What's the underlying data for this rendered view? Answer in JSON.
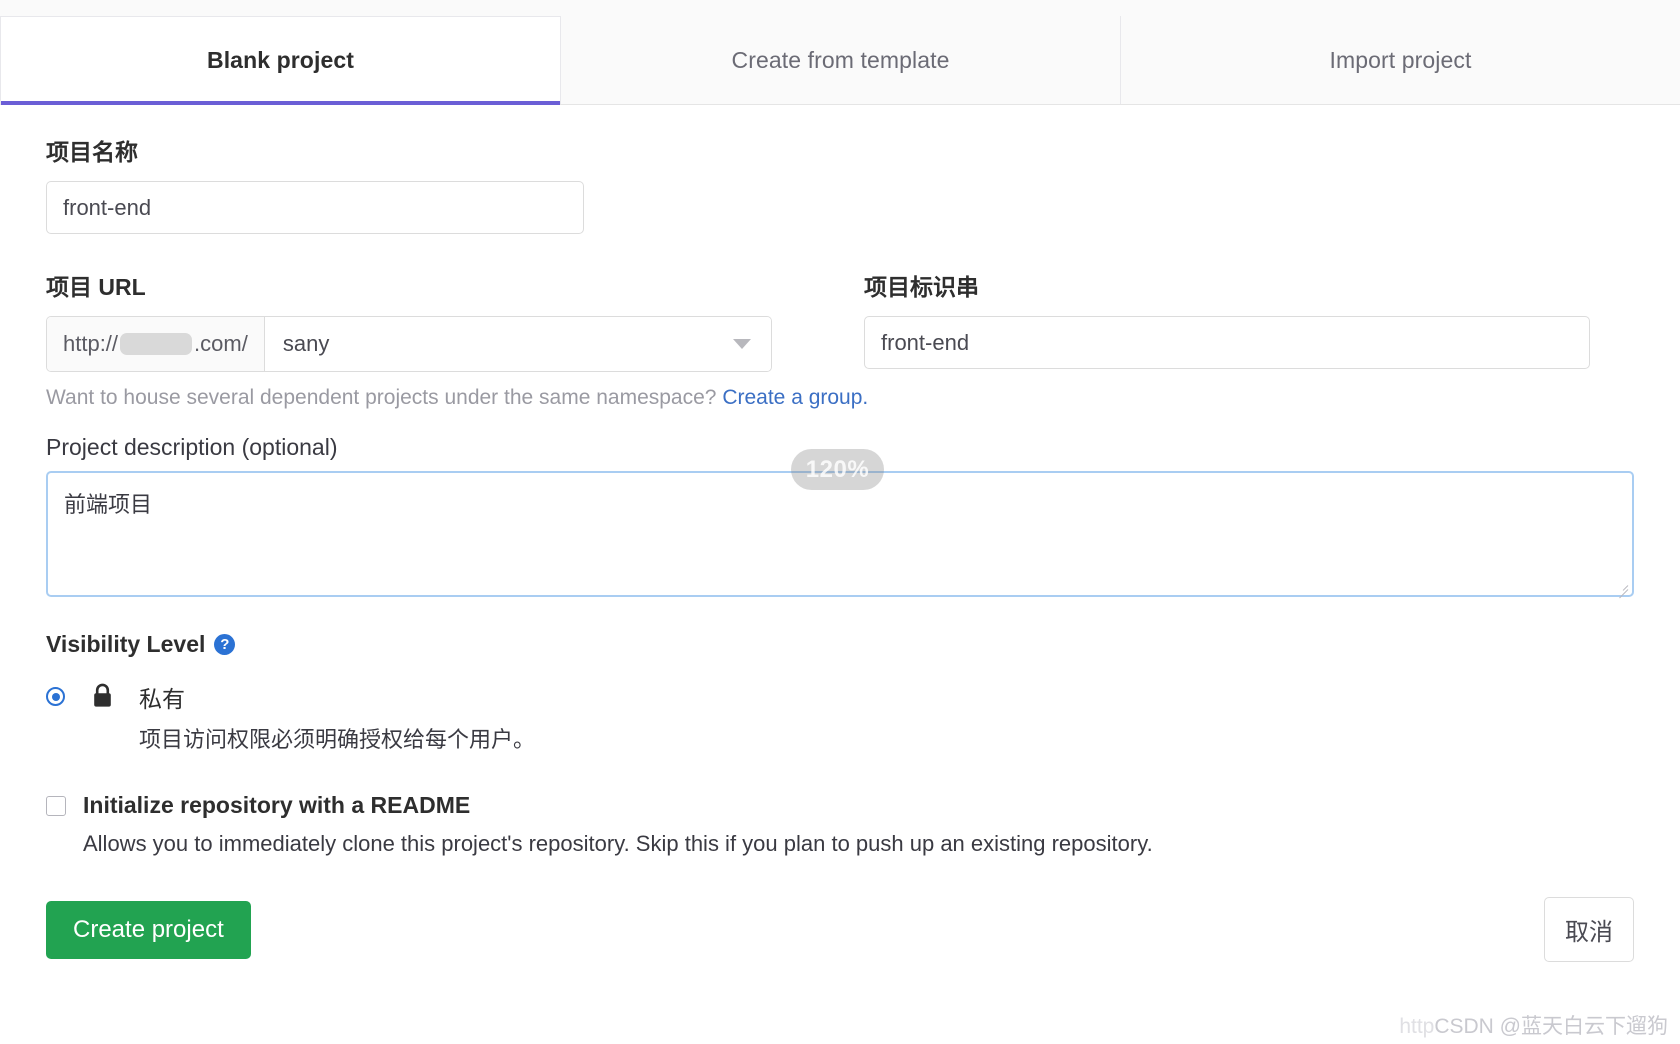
{
  "tabs": [
    {
      "label": "Blank project",
      "active": true
    },
    {
      "label": "Create from template",
      "active": false
    },
    {
      "label": "Import project",
      "active": false
    }
  ],
  "project_name": {
    "label": "项目名称",
    "value": "front-end"
  },
  "project_url": {
    "label": "项目 URL",
    "prefix_scheme": "http://",
    "prefix_redacted": "",
    "prefix_suffix": ".com/",
    "namespace_value": "sany",
    "chevron_icon": "chevron-down-icon"
  },
  "project_slug": {
    "label": "项目标识串",
    "value": "front-end"
  },
  "helper": {
    "text": "Want to house several dependent projects under the same namespace?",
    "link_text": "Create a group."
  },
  "description": {
    "label": "Project description (optional)",
    "value": "前端项目"
  },
  "zoom_badge": {
    "value": "120%"
  },
  "visibility": {
    "title": "Visibility Level",
    "help_icon": "question-mark-icon",
    "options": [
      {
        "icon": "lock-icon",
        "name": "私有",
        "description": "项目访问权限必须明确授权给每个用户。",
        "selected": true
      }
    ]
  },
  "readme": {
    "label": "Initialize repository with a README",
    "description": "Allows you to immediately clone this project's repository. Skip this if you plan to push up an existing repository.",
    "checked": false
  },
  "footer": {
    "create_label": "Create project",
    "cancel_label": "取消"
  },
  "watermark": {
    "faint_prefix": "http",
    "text": "CSDN @蓝天白云下遛狗"
  },
  "colors": {
    "tab_active_underline": "#6b5ed6",
    "create_button": "#22a351",
    "link": "#3b6fc4",
    "radio_accent": "#2b72d4",
    "textarea_focus_border": "#a9cdf2"
  }
}
